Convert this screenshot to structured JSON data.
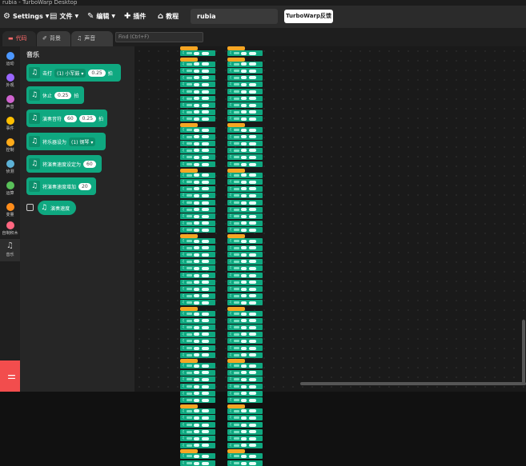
{
  "window": {
    "title": "rubia - TurboWarp Desktop"
  },
  "menubar": {
    "settings": "Settings",
    "file": "文件",
    "edit": "编辑",
    "addons": "插件",
    "tutorials": "教程",
    "project_title": "rubia",
    "feedback": "TurboWarp反馈"
  },
  "tabs": {
    "code": "代码",
    "costumes": "背景",
    "sounds": "声音"
  },
  "find": {
    "placeholder": "Find (Ctrl+F)"
  },
  "categories": [
    {
      "label": "运动",
      "color": "#4c97ff"
    },
    {
      "label": "外观",
      "color": "#9966ff"
    },
    {
      "label": "声音",
      "color": "#cf63cf"
    },
    {
      "label": "事件",
      "color": "#ffbf00"
    },
    {
      "label": "控制",
      "color": "#ffab19"
    },
    {
      "label": "侦测",
      "color": "#5cb1d6"
    },
    {
      "label": "运算",
      "color": "#59c059"
    },
    {
      "label": "变量",
      "color": "#ff8c1a"
    },
    {
      "label": "自制积木",
      "color": "#ff6680"
    },
    {
      "label": "音乐",
      "color": "#0fbd8c"
    }
  ],
  "palette": {
    "title": "音乐",
    "blocks": [
      {
        "text1": "击打",
        "dropdown": "(1) 小军鼓",
        "value": "0.25",
        "text2": "拍"
      },
      {
        "text1": "休止",
        "value": "0.25",
        "text2": "拍"
      },
      {
        "text1": "演奏音符",
        "value1": "60",
        "value": "0.25",
        "text2": "拍"
      },
      {
        "text1": "将乐器设为",
        "dropdown": "(1) 钢琴"
      },
      {
        "text1": "将演奏速度设定为",
        "value": "60"
      },
      {
        "text1": "将演奏速度增加",
        "value": "20"
      }
    ],
    "reporter": "演奏速度"
  },
  "colors": {
    "music": "#0fa880",
    "event": "#f5a623",
    "accent": "#f24d4d"
  }
}
